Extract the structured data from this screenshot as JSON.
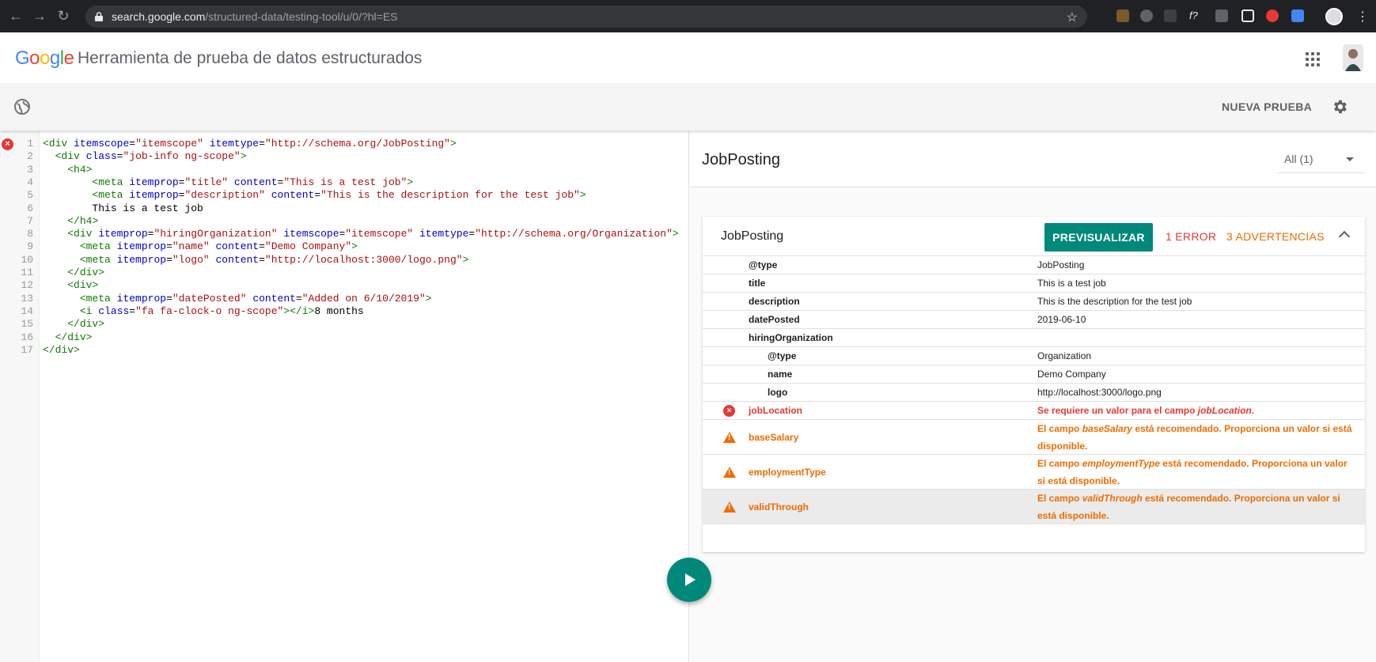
{
  "browser": {
    "url_host": "search.google.com",
    "url_path": "/structured-data/testing-tool/u/0/?hl=ES"
  },
  "app": {
    "logo_letters": [
      "G",
      "o",
      "o",
      "g",
      "l",
      "e"
    ],
    "title": "Herramienta de prueba de datos estructurados"
  },
  "toolbar": {
    "new_test_label": "NUEVA PRUEBA"
  },
  "editor": {
    "lines": [
      {
        "n": "1",
        "code": "<div itemscope=\"itemscope\" itemtype=\"http://schema.org/JobPosting\">"
      },
      {
        "n": "2",
        "code": "  <div class=\"job-info ng-scope\">"
      },
      {
        "n": "3",
        "code": "    <h4>"
      },
      {
        "n": "4",
        "code": "        <meta itemprop=\"title\" content=\"This is a test job\">"
      },
      {
        "n": "5",
        "code": "        <meta itemprop=\"description\" content=\"This is the description for the test job\">"
      },
      {
        "n": "6",
        "code": "        This is a test job"
      },
      {
        "n": "7",
        "code": "    </h4>"
      },
      {
        "n": "8",
        "code": "    <div itemprop=\"hiringOrganization\" itemscope=\"itemscope\" itemtype=\"http://schema.org/Organization\">"
      },
      {
        "n": "9",
        "code": "      <meta itemprop=\"name\" content=\"Demo Company\">"
      },
      {
        "n": "10",
        "code": "      <meta itemprop=\"logo\" content=\"http://localhost:3000/logo.png\">"
      },
      {
        "n": "11",
        "code": "    </div>"
      },
      {
        "n": "12",
        "code": "    <div>"
      },
      {
        "n": "13",
        "code": "      <meta itemprop=\"datePosted\" content=\"Added on 6/10/2019\">"
      },
      {
        "n": "14",
        "code": "      <i class=\"fa fa-clock-o ng-scope\"></i>8 months"
      },
      {
        "n": "15",
        "code": "    </div>"
      },
      {
        "n": "16",
        "code": "  </div>"
      },
      {
        "n": "17",
        "code": "</div>"
      }
    ]
  },
  "results": {
    "title": "JobPosting",
    "filter_value": "All (1)",
    "card": {
      "title": "JobPosting",
      "preview_label": "PREVISUALIZAR",
      "error_count": "1 ERROR",
      "warning_count": "3 ADVERTENCIAS",
      "rows": [
        {
          "key": "@type",
          "value": "JobPosting"
        },
        {
          "key": "title",
          "value": "This is a test job"
        },
        {
          "key": "description",
          "value": "This is the description for the test job"
        },
        {
          "key": "datePosted",
          "value": "2019-06-10"
        },
        {
          "key": "hiringOrganization",
          "value": ""
        },
        {
          "key": "@type",
          "value": "Organization"
        },
        {
          "key": "name",
          "value": "Demo Company"
        },
        {
          "key": "logo",
          "value": "http://localhost:3000/logo.png"
        }
      ],
      "issues": [
        {
          "key": "jobLocation",
          "pre": "Se requiere un valor para el campo ",
          "field": "jobLocation",
          "post": "."
        },
        {
          "key": "baseSalary",
          "pre": "El campo ",
          "field": "baseSalary",
          "post": " está recomendado. Proporciona un valor si está disponible."
        },
        {
          "key": "employmentType",
          "pre": "El campo ",
          "field": "employmentType",
          "post": " está recomendado. Proporciona un valor si está disponible."
        },
        {
          "key": "validThrough",
          "pre": "El campo ",
          "field": "validThrough",
          "post": " está recomendado. Proporciona un valor si está disponible."
        }
      ]
    }
  },
  "colors": {
    "accent": "#00897b",
    "error": "#e53935",
    "warning": "#ef6c00"
  }
}
